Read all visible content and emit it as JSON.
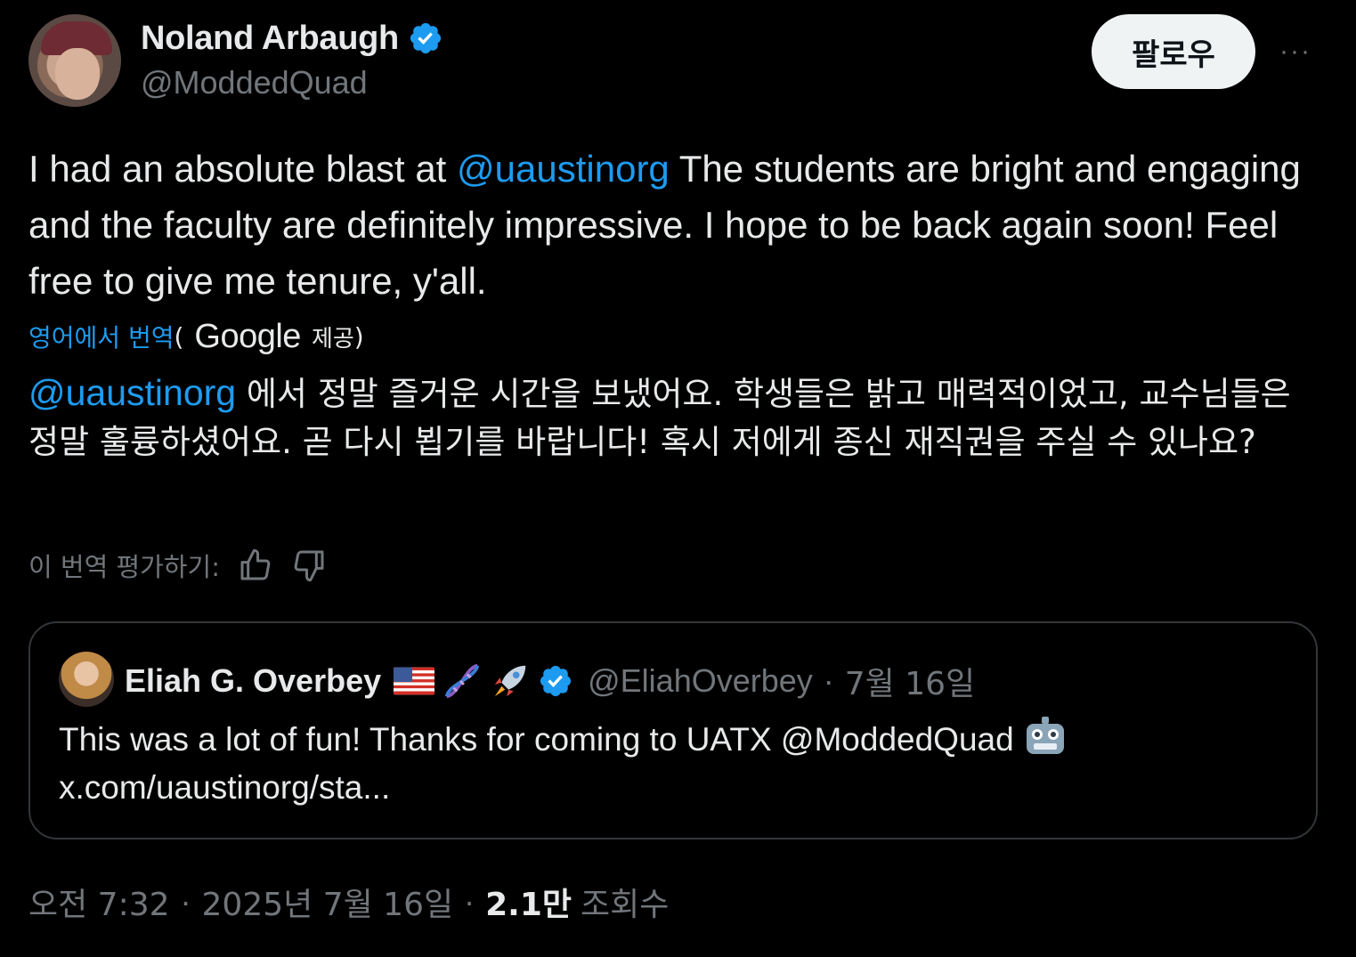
{
  "author": {
    "name": "Noland Arbaugh",
    "handle": "@ModdedQuad"
  },
  "follow_label": "팔로우",
  "more_label": "···",
  "tweet": {
    "text_before": "I had an absolute blast at ",
    "mention": "@uaustinorg",
    "text_after": " The students are bright and engaging and the faculty are definitely impressive. I hope to be back again soon! Feel free to give me tenure, y'all."
  },
  "translation": {
    "link_label": "영어에서 번역",
    "paren_open": "(",
    "provider": "Google",
    "provided_label": "제공",
    "paren_close": ")",
    "mention": "@uaustinorg",
    "text": " 에서 정말 즐거운 시간을 보냈어요. 학생들은 밝고 매력적이었고, 교수님들은 정말 훌륭하셨어요. 곧 다시 뵙기를 바랍니다! 혹시 저에게 종신 재직권을 주실 수 있나요?",
    "rate_label": "이 번역 평가하기:"
  },
  "quote": {
    "name": "Eliah G. Overbey",
    "handle": "@EliahOverbey",
    "dot": "·",
    "date": "7월 16일",
    "text": "This was a lot of fun! Thanks for coming to UATX @ModdedQuad",
    "link": "x.com/uaustinorg/sta..."
  },
  "footer": {
    "time": "오전 7:32",
    "sep1": "·",
    "date": "2025년 7월 16일",
    "sep2": "·",
    "views": "2.1만",
    "views_label": "조회수"
  },
  "colors": {
    "background": "#000000",
    "text": "#e7e9ea",
    "secondary": "#71767b",
    "link": "#1d9bf0",
    "border": "#333639"
  }
}
